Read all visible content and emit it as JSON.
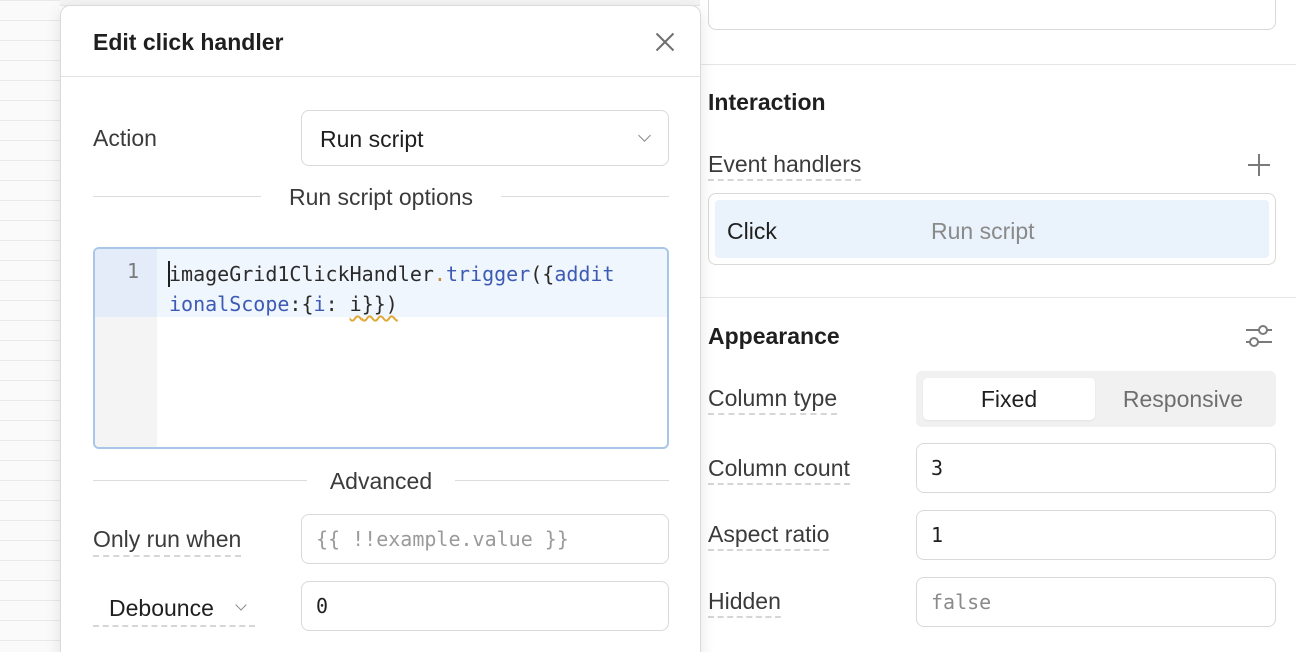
{
  "modal": {
    "title": "Edit click handler",
    "action_label": "Action",
    "action_value": "Run script",
    "options_heading": "Run script options",
    "code": {
      "line_number": "1",
      "tokens": [
        "imageGrid1ClickHandler",
        ".",
        "trigger",
        "({",
        "addit",
        "ionalScope",
        ":{",
        "i",
        ": ",
        "i",
        "}})"
      ]
    },
    "advanced_heading": "Advanced",
    "only_run_when_label": "Only run when",
    "only_run_when_placeholder": "{{ !!example.value }}",
    "debounce_label": "Debounce",
    "debounce_value": "0"
  },
  "inspector": {
    "interaction_title": "Interaction",
    "event_handlers_label": "Event handlers",
    "handler": {
      "event": "Click",
      "action": "Run script"
    },
    "appearance_title": "Appearance",
    "column_type_label": "Column type",
    "column_type_options": [
      "Fixed",
      "Responsive"
    ],
    "column_type_selected": "Fixed",
    "column_count_label": "Column count",
    "column_count_value": "3",
    "aspect_ratio_label": "Aspect ratio",
    "aspect_ratio_value": "1",
    "hidden_label": "Hidden",
    "hidden_placeholder": "false"
  }
}
